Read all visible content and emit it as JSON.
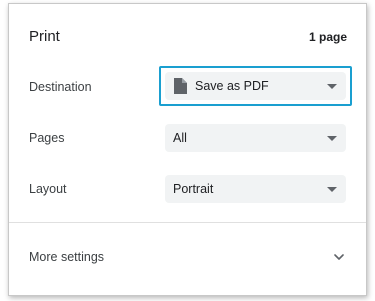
{
  "header": {
    "title": "Print",
    "page_count": "1 page"
  },
  "destination": {
    "label": "Destination",
    "value": "Save as PDF",
    "icon": "document-icon",
    "highlight_color": "#1a9fd0"
  },
  "pages": {
    "label": "Pages",
    "value": "All"
  },
  "layout": {
    "label": "Layout",
    "value": "Portrait"
  },
  "more_settings": {
    "label": "More settings",
    "icon": "chevron-down-icon"
  }
}
